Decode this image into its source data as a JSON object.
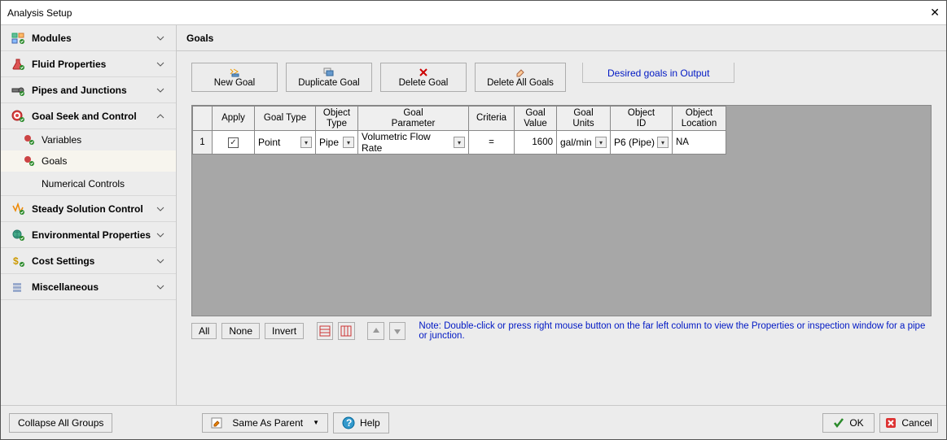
{
  "window": {
    "title": "Analysis Setup"
  },
  "sidebar": {
    "items": [
      {
        "label": "Modules"
      },
      {
        "label": "Fluid Properties"
      },
      {
        "label": "Pipes and Junctions"
      },
      {
        "label": "Goal Seek and Control"
      },
      {
        "label": "Steady Solution Control"
      },
      {
        "label": "Environmental Properties"
      },
      {
        "label": "Cost Settings"
      },
      {
        "label": "Miscellaneous"
      }
    ],
    "subitems": [
      {
        "label": "Variables"
      },
      {
        "label": "Goals"
      },
      {
        "label": "Numerical Controls"
      }
    ]
  },
  "main": {
    "heading": "Goals",
    "toolbar": {
      "new_goal": "New Goal",
      "duplicate_goal": "Duplicate Goal",
      "delete_goal": "Delete Goal",
      "delete_all_goals": "Delete All Goals"
    },
    "link_label": "Desired goals in Output",
    "grid": {
      "headers": [
        "",
        "Apply",
        "Goal Type",
        "Object\nType",
        "Goal\nParameter",
        "Criteria",
        "Goal\nValue",
        "Goal\nUnits",
        "Object\nID",
        "Object\nLocation"
      ],
      "row": {
        "num": "1",
        "apply_checked": true,
        "goal_type": "Point",
        "object_type": "Pipe",
        "goal_parameter": "Volumetric Flow Rate",
        "criteria": "=",
        "goal_value": "1600",
        "goal_units": "gal/min",
        "object_id": "P6 (Pipe)",
        "object_location": "NA"
      }
    },
    "below": {
      "all": "All",
      "none": "None",
      "invert": "Invert",
      "note": "Note: Double-click or press right mouse button on the far left column to view the Properties or inspection window for a pipe or junction."
    }
  },
  "footer": {
    "collapse": "Collapse All Groups",
    "same_as_parent": "Same As Parent",
    "help": "Help",
    "ok": "OK",
    "cancel": "Cancel"
  }
}
